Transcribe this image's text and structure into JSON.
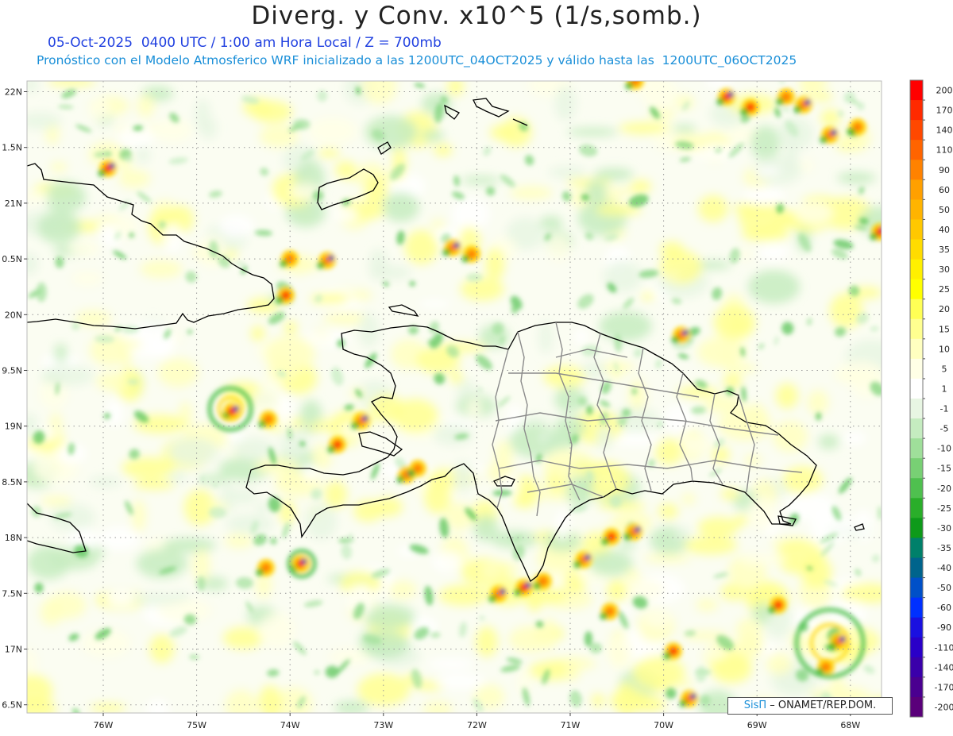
{
  "header": {
    "title": "Diverg. y Conv. x10^5 (1/s,somb.)",
    "subtitle_date": "05-Oct-2025  0400 UTC / 1:00 am Hora Local / Z = 700mb",
    "subtitle_model": "Pronóstico con el Modelo Atmosferico WRF inicializado a las 1200UTC_04OCT2025 y válido hasta las  1200UTC_06OCT2025"
  },
  "map": {
    "lat_labels": [
      "22N",
      "1.5N",
      "21N",
      "0.5N",
      "20N",
      "9.5N",
      "19N",
      "8.5N",
      "18N",
      "7.5N",
      "17N",
      "6.5N"
    ],
    "lon_labels": [
      "76W",
      "75W",
      "74W",
      "73W",
      "72W",
      "71W",
      "70W",
      "69W",
      "68W"
    ],
    "lat_range": [
      16.5,
      22.0
    ],
    "lon_range": [
      -76.6,
      -67.6
    ],
    "grid": "dotted"
  },
  "colorbar": {
    "levels": [
      "200",
      "170",
      "140",
      "110",
      "90",
      "60",
      "50",
      "40",
      "35",
      "30",
      "25",
      "20",
      "15",
      "10",
      "5",
      "1",
      "-1",
      "-5",
      "-10",
      "-15",
      "-20",
      "-25",
      "-30",
      "-35",
      "-40",
      "-50",
      "-60",
      "-90",
      "-110",
      "-140",
      "-170",
      "-200"
    ],
    "colors": [
      "#ff0000",
      "#ff2a00",
      "#ff4800",
      "#ff6400",
      "#ff8200",
      "#ffa000",
      "#ffb400",
      "#ffc800",
      "#ffdc00",
      "#fff000",
      "#ffff00",
      "#ffff55",
      "#ffff90",
      "#ffffc0",
      "#ffffe6",
      "#ffffff",
      "#e8f6e3",
      "#c5ecc0",
      "#9fdf9a",
      "#78d074",
      "#4fc04f",
      "#2aae2a",
      "#0e9a1a",
      "#00806a",
      "#00648c",
      "#0050c8",
      "#0030ff",
      "#1a10e0",
      "#2a00c8",
      "#3a00aa",
      "#4a0090",
      "#5a007a"
    ]
  },
  "credit": {
    "brand": "SisΠ",
    "org": "– ONAMET/REP.DOM."
  }
}
